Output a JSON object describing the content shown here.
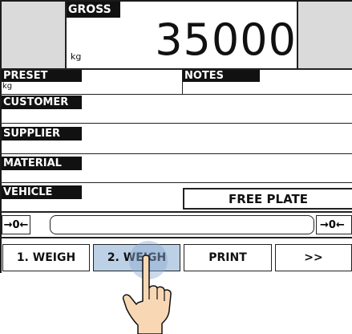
{
  "scale": {
    "gross_label": "GROSS",
    "unit": "kg",
    "weight": "35000"
  },
  "fields": {
    "preset_label": "PRESET",
    "preset_unit": "kg",
    "notes_label": "NOTES",
    "customer_label": "CUSTOMER",
    "supplier_label": "SUPPLIER",
    "material_label": "MATERIAL",
    "vehicle_label": "VEHICLE",
    "free_plate": "FREE PLATE"
  },
  "zero": {
    "left_label": "→0←",
    "right_label": "→0←"
  },
  "buttons": {
    "weigh1": "1. WEIGH",
    "weigh2": "2. WEIGH",
    "print": "PRINT",
    "more": ">>"
  },
  "colors": {
    "selected": "#bcd0e6",
    "side_panel": "#dadada"
  }
}
